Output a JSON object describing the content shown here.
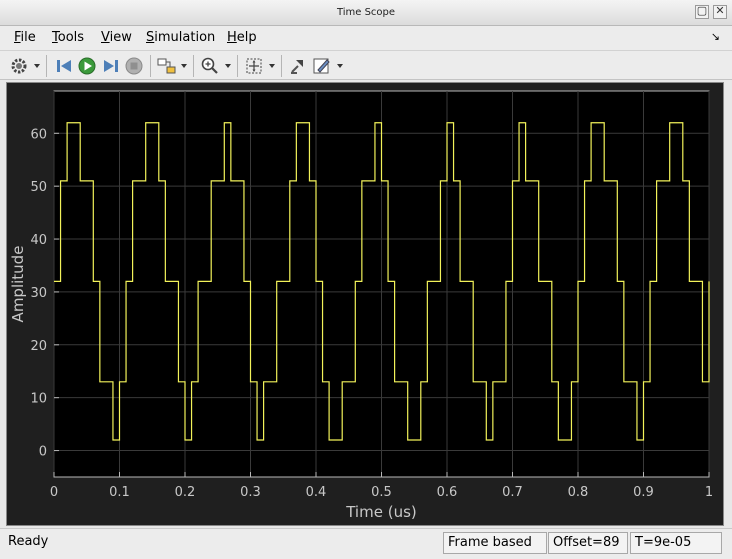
{
  "window": {
    "title": "Time Scope"
  },
  "menu": {
    "items": [
      {
        "key": "F",
        "rest": "ile"
      },
      {
        "key": "T",
        "rest": "ools"
      },
      {
        "key": "V",
        "rest": "iew"
      },
      {
        "key": "S",
        "rest": "imulation"
      },
      {
        "key": "H",
        "rest": "elp"
      }
    ]
  },
  "toolbar": {
    "icons": [
      "settings-gear-icon",
      "step-back-icon",
      "run-icon",
      "step-forward-icon",
      "stop-icon",
      "highlight-block-icon",
      "zoom-in-icon",
      "autoscale-icon",
      "restore-view-icon",
      "edit-style-icon"
    ]
  },
  "status": {
    "ready": "Ready",
    "mode": "Frame based",
    "offset": "Offset=89",
    "time": "T=9e-05"
  },
  "chart_data": {
    "type": "line",
    "xlabel": "Time (us)",
    "ylabel": "Amplitude",
    "xlim": [
      0,
      1
    ],
    "ylim": [
      -5,
      68
    ],
    "xticks": [
      "0",
      "0.1",
      "0.2",
      "0.3",
      "0.4",
      "0.5",
      "0.6",
      "0.7",
      "0.8",
      "0.9",
      "1"
    ],
    "yticks": [
      "0",
      "10",
      "20",
      "30",
      "40",
      "50",
      "60"
    ],
    "grid": true,
    "background": "#000000",
    "axes_color": "#b8b8b8",
    "series": [
      {
        "color": "#f2f25a",
        "step": true,
        "x": [
          0,
          0.01,
          0.02,
          0.04,
          0.06,
          0.07,
          0.09,
          0.1,
          0.11,
          0.12,
          0.14,
          0.16,
          0.17,
          0.19,
          0.2,
          0.21,
          0.22,
          0.24,
          0.26,
          0.27,
          0.29,
          0.3,
          0.31,
          0.32,
          0.34,
          0.36,
          0.37,
          0.39,
          0.4,
          0.41,
          0.42,
          0.44,
          0.46,
          0.47,
          0.49,
          0.5,
          0.51,
          0.52,
          0.54,
          0.56,
          0.57,
          0.59,
          0.6,
          0.61,
          0.62,
          0.64,
          0.66,
          0.67,
          0.69,
          0.7,
          0.71,
          0.72,
          0.74,
          0.76,
          0.77,
          0.79,
          0.8,
          0.81,
          0.82,
          0.84,
          0.86,
          0.87,
          0.89,
          0.9,
          0.91,
          0.92,
          0.94,
          0.96,
          0.97,
          0.99,
          1
        ],
        "y": [
          32,
          51,
          62,
          51,
          32,
          13,
          2,
          13,
          32,
          51,
          62,
          51,
          32,
          13,
          2,
          13,
          32,
          51,
          62,
          51,
          32,
          13,
          2,
          13,
          32,
          51,
          62,
          51,
          32,
          13,
          2,
          13,
          32,
          51,
          62,
          51,
          32,
          13,
          2,
          13,
          32,
          51,
          62,
          51,
          32,
          13,
          2,
          13,
          32,
          51,
          62,
          51,
          32,
          13,
          2,
          13,
          32,
          51,
          62,
          51,
          32,
          13,
          2,
          13,
          32,
          51,
          62,
          51,
          32,
          13,
          32
        ]
      }
    ]
  }
}
